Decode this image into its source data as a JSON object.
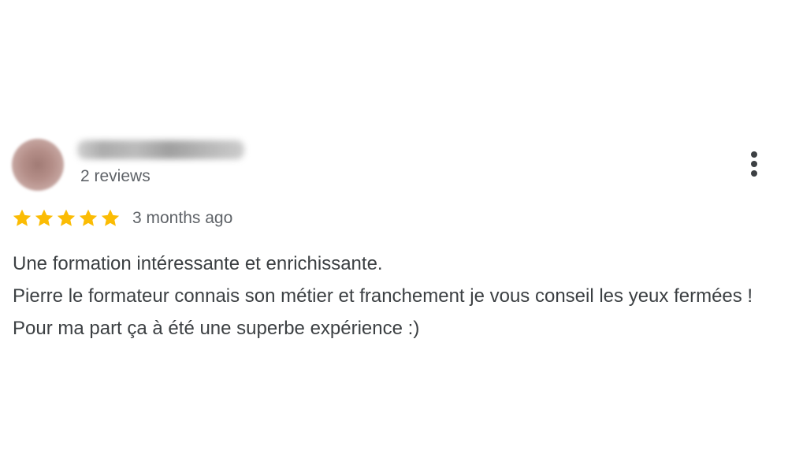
{
  "review": {
    "author": {
      "name": "",
      "name_blurred": true,
      "reviews_count": "2 reviews"
    },
    "rating": {
      "stars": 5,
      "max_stars": 5,
      "star_color": "#fbbc04"
    },
    "date": "3 months ago",
    "text_lines": [
      "Une formation intéressante et enrichissante.",
      "Pierre le formateur connais son métier et franchement je vous conseil les yeux fermées ! Pour ma part ça à été une superbe expérience :)"
    ],
    "menu_icon": "more-vert-icon"
  }
}
